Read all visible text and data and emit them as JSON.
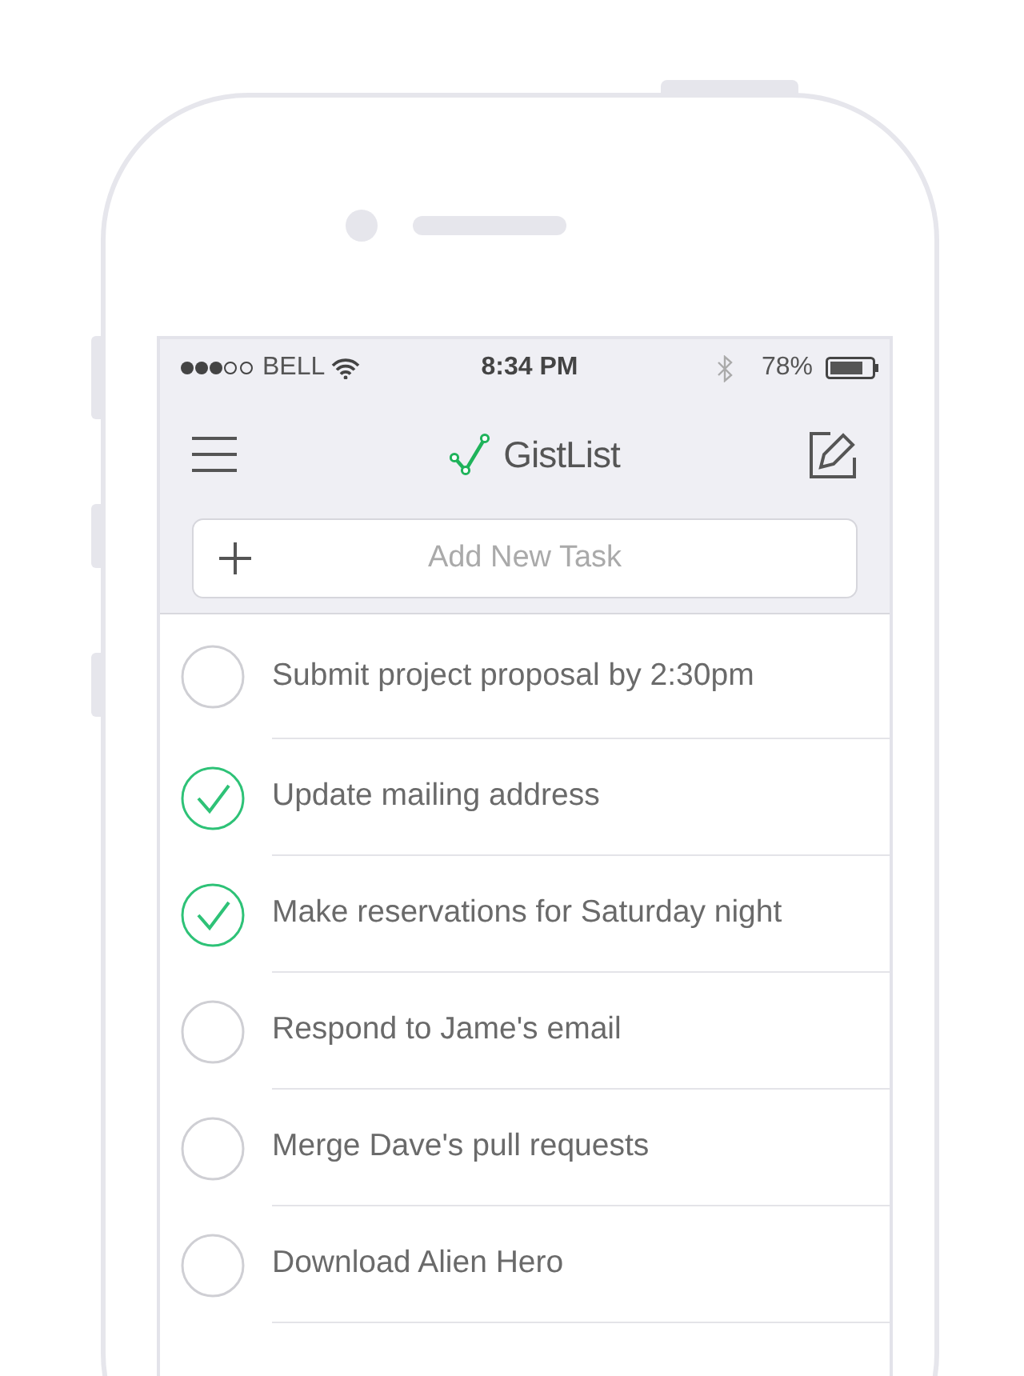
{
  "status_bar": {
    "carrier": "BELL",
    "time": "8:34 PM",
    "battery": "78%"
  },
  "nav": {
    "title": "GistList"
  },
  "add_task": {
    "placeholder": "Add New Task"
  },
  "tasks": [
    {
      "label": "Submit project proposal by 2:30pm",
      "checked": false
    },
    {
      "label": "Update mailing address",
      "checked": true
    },
    {
      "label": "Make reservations for Saturday night",
      "checked": true
    },
    {
      "label": "Respond to Jame's email",
      "checked": false
    },
    {
      "label": "Merge Dave's pull requests",
      "checked": false
    },
    {
      "label": "Download Alien Hero",
      "checked": false
    }
  ]
}
